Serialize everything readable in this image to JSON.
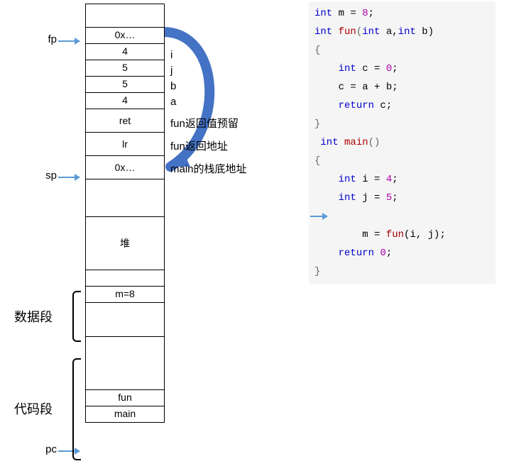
{
  "pointers": {
    "fp": "fp",
    "sp": "sp",
    "pc": "pc"
  },
  "stack_cells": {
    "c0": "",
    "c1": "0x…",
    "c2": "4",
    "c3": "5",
    "c4": "5",
    "c5": "4",
    "c6": "ret",
    "c7": "lr",
    "c8": "0x…",
    "c9": "",
    "c10": "堆",
    "c11": "",
    "c12": "m=8",
    "c13": "",
    "c14": "",
    "c15": "fun",
    "c16": "main"
  },
  "annotations": {
    "i": "i",
    "j": "j",
    "b": "b",
    "a": "a",
    "ret": "fun返回值预留",
    "lr": "fun返回地址",
    "mainfp": "main的栈底地址"
  },
  "segments": {
    "data": "数据段",
    "code": "代码段"
  },
  "code": {
    "l1_kw1": "int",
    "l1_rest": " m = ",
    "l1_num": "8",
    "l1_semi": ";",
    "l2_kw1": "int",
    "l2_fn": " fun",
    "l2_p1": "(",
    "l2_kw2": "int",
    "l2_a": " a,",
    "l2_kw3": "int",
    "l2_b": " b)",
    "l3": "{",
    "l4_kw": "int",
    "l4_rest": " c = ",
    "l4_num": "0",
    "l4_semi": ";",
    "l5": "    c = a + b;",
    "l6_kw": "return",
    "l6_rest": " c;",
    "l7": "}",
    "l8_kw": "int",
    "l8_fn": " main",
    "l8_p": "()",
    "l9": "{",
    "l10_kw": "int",
    "l10_rest": " i = ",
    "l10_num": "4",
    "l10_semi": ";",
    "l11_kw": "int",
    "l11_rest": " j = ",
    "l11_num": "5",
    "l11_semi": ";",
    "l12_pre": "    m = ",
    "l12_fn": "fun",
    "l12_args": "(i, j);",
    "l13_kw": "return",
    "l13_sp": " ",
    "l13_num": "0",
    "l13_semi": ";",
    "l14": "}"
  },
  "chart_data": {
    "type": "table",
    "description": "Memory layout diagram with stack frames, heap, data segment, code segment; plus C source code on the right.",
    "memory_layout": [
      {
        "region": "stack",
        "cells": [
          {
            "value": "",
            "note": ""
          },
          {
            "value": "0x…",
            "note": "fp points here"
          },
          {
            "value": "4",
            "note": "i"
          },
          {
            "value": "5",
            "note": "j"
          },
          {
            "value": "5",
            "note": "b"
          },
          {
            "value": "4",
            "note": "a"
          },
          {
            "value": "ret",
            "note": "fun返回值预留"
          },
          {
            "value": "lr",
            "note": "fun返回地址"
          },
          {
            "value": "0x…",
            "note": "main的栈底地址 / sp points here"
          }
        ]
      },
      {
        "region": "heap",
        "label": "堆"
      },
      {
        "region": "data-segment",
        "label": "数据段",
        "cells": [
          "m=8"
        ]
      },
      {
        "region": "code-segment",
        "label": "代码段",
        "cells": [
          "fun",
          "main"
        ],
        "pc_points_to": "main"
      }
    ],
    "source_code": [
      "int m = 8;",
      "int fun(int a,int b)",
      "{",
      "    int c = 0;",
      "    c = a + b;",
      "    return c;",
      "}",
      "int main()",
      "{",
      "    int i = 4;",
      "    int j = 5;",
      "    m = fun(i, j);",
      "    return 0;",
      "}"
    ],
    "current_line_arrow": "m = fun(i, j);"
  }
}
